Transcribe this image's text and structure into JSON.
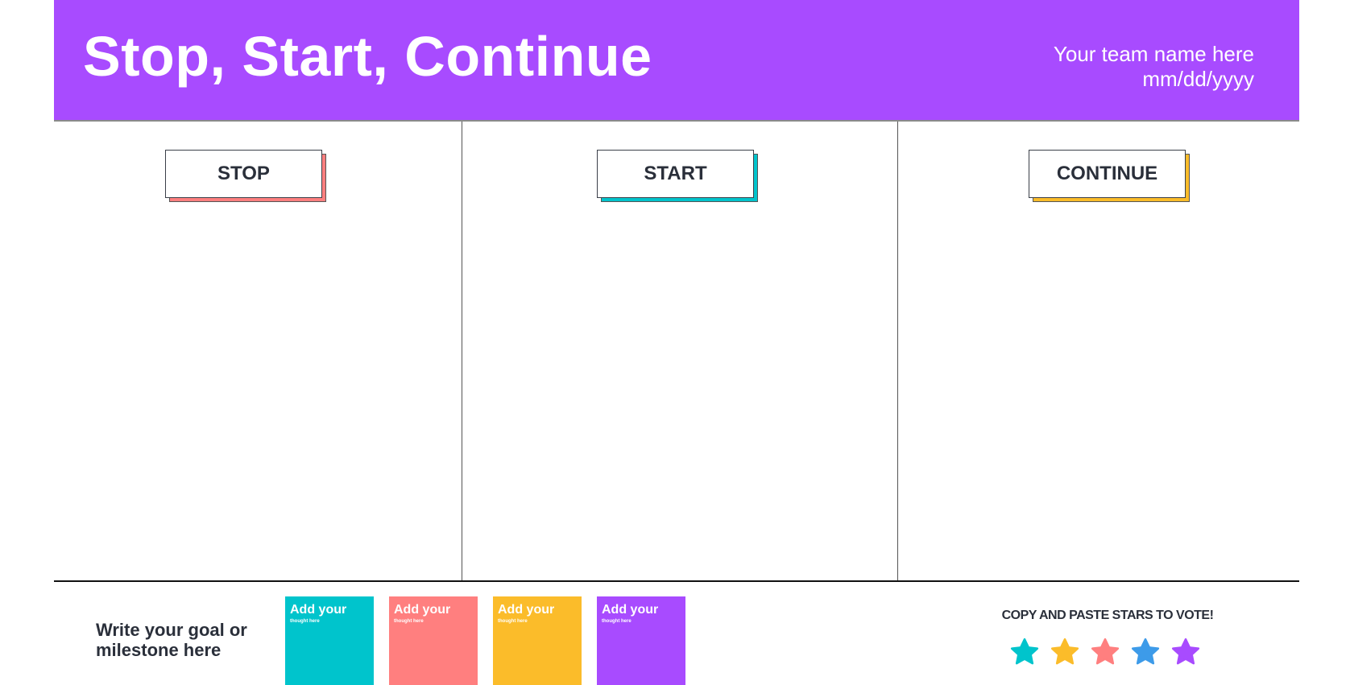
{
  "header": {
    "title": "Stop, Start, Continue",
    "team_name": "Your team name here",
    "date": "mm/dd/yyyy",
    "background_color": "#a84bff"
  },
  "columns": [
    {
      "label": "STOP",
      "accent_color": "#ff7f7f"
    },
    {
      "label": "START",
      "accent_color": "#00c4cc"
    },
    {
      "label": "CONTINUE",
      "accent_color": "#fbbc2a"
    }
  ],
  "footer": {
    "goal_text_line1": "Write your goal or",
    "goal_text_line2": "milestone here",
    "sticky_notes": [
      {
        "title": "Add your",
        "subtitle": "thought here",
        "color": "#00c4cc"
      },
      {
        "title": "Add your",
        "subtitle": "thought here",
        "color": "#ff7f7f"
      },
      {
        "title": "Add your",
        "subtitle": "thought here",
        "color": "#fbbc2a"
      },
      {
        "title": "Add your",
        "subtitle": "thought here",
        "color": "#a84bff"
      }
    ],
    "vote_label": "COPY AND PASTE STARS TO VOTE!",
    "stars": [
      {
        "icon": "star-icon",
        "color": "#00c4cc"
      },
      {
        "icon": "star-icon",
        "color": "#fbbc2a"
      },
      {
        "icon": "star-icon",
        "color": "#ff7f7f"
      },
      {
        "icon": "star-icon",
        "color": "#3d9be9"
      },
      {
        "icon": "star-icon",
        "color": "#a84bff"
      }
    ]
  }
}
